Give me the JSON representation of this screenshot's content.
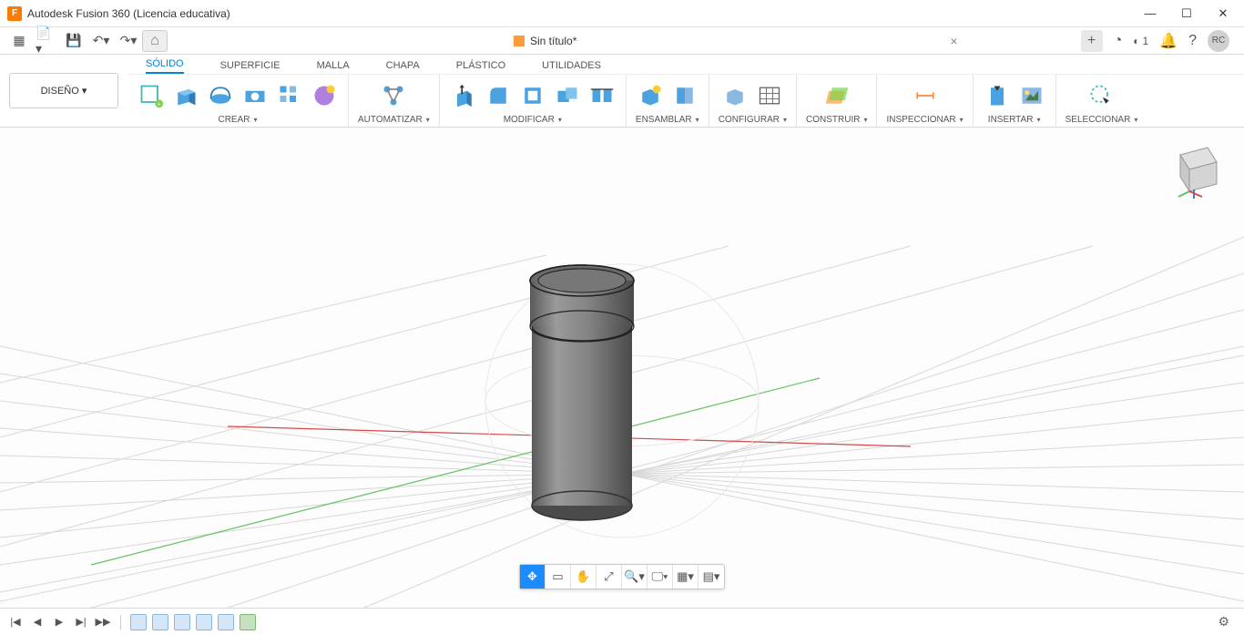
{
  "titlebar": {
    "title": "Autodesk Fusion 360 (Licencia educativa)"
  },
  "quickbar": {
    "jobs_count": "1",
    "avatar_initials": "RC"
  },
  "document": {
    "name": "Sin título*"
  },
  "workspace": {
    "label": "DISEÑO"
  },
  "tabs": [
    {
      "label": "SÓLIDO",
      "active": true
    },
    {
      "label": "SUPERFICIE",
      "active": false
    },
    {
      "label": "MALLA",
      "active": false
    },
    {
      "label": "CHAPA",
      "active": false
    },
    {
      "label": "PLÁSTICO",
      "active": false
    },
    {
      "label": "UTILIDADES",
      "active": false
    }
  ],
  "groups": {
    "crear": "CREAR",
    "automatizar": "AUTOMATIZAR",
    "modificar": "MODIFICAR",
    "ensamblar": "ENSAMBLAR",
    "configurar": "CONFIGURAR",
    "construir": "CONSTRUIR",
    "inspeccionar": "INSPECCIONAR",
    "insertar": "INSERTAR",
    "seleccionar": "SELECCIONAR"
  },
  "colors": {
    "accent": "#0a7fd4",
    "tool_blue": "#4aa3e0",
    "tool_teal": "#3fb5b5",
    "tool_orange": "#ffa94d"
  }
}
